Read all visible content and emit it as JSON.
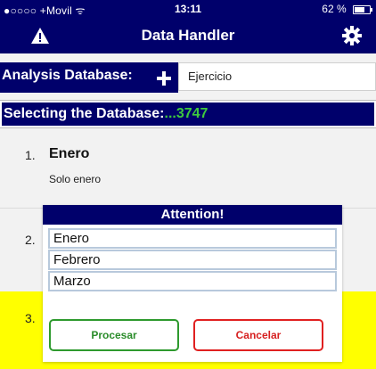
{
  "status_bar": {
    "carrier": "●○○○○ +Movil",
    "wifi_symbol": "ᯤ",
    "time": "13:11",
    "battery": "62 %",
    "battery_level": 0.62
  },
  "header": {
    "title": "Data Handler"
  },
  "analysis": {
    "label": "Analysis Database:",
    "value": "Ejercicio"
  },
  "selecting": {
    "label": "Selecting the Database:",
    "id": "...3747"
  },
  "list": {
    "items": [
      {
        "num": "1.",
        "title": "Enero",
        "subtitle": "Solo enero"
      },
      {
        "num": "2."
      },
      {
        "num": "3."
      }
    ]
  },
  "dialog": {
    "title": "Attention!",
    "options": [
      "Enero",
      "Febrero",
      "Marzo"
    ],
    "ok_label": "Procesar",
    "cancel_label": "Cancelar"
  },
  "colors": {
    "navy": "#00006b",
    "id_green": "#3ec93e",
    "highlight_yellow": "#ffff00",
    "ok_green": "#2e9a2e",
    "cancel_red": "#e02020"
  },
  "icons": [
    "warning-icon",
    "gear-icon",
    "plus-icon",
    "battery-icon",
    "wifi-icon"
  ]
}
